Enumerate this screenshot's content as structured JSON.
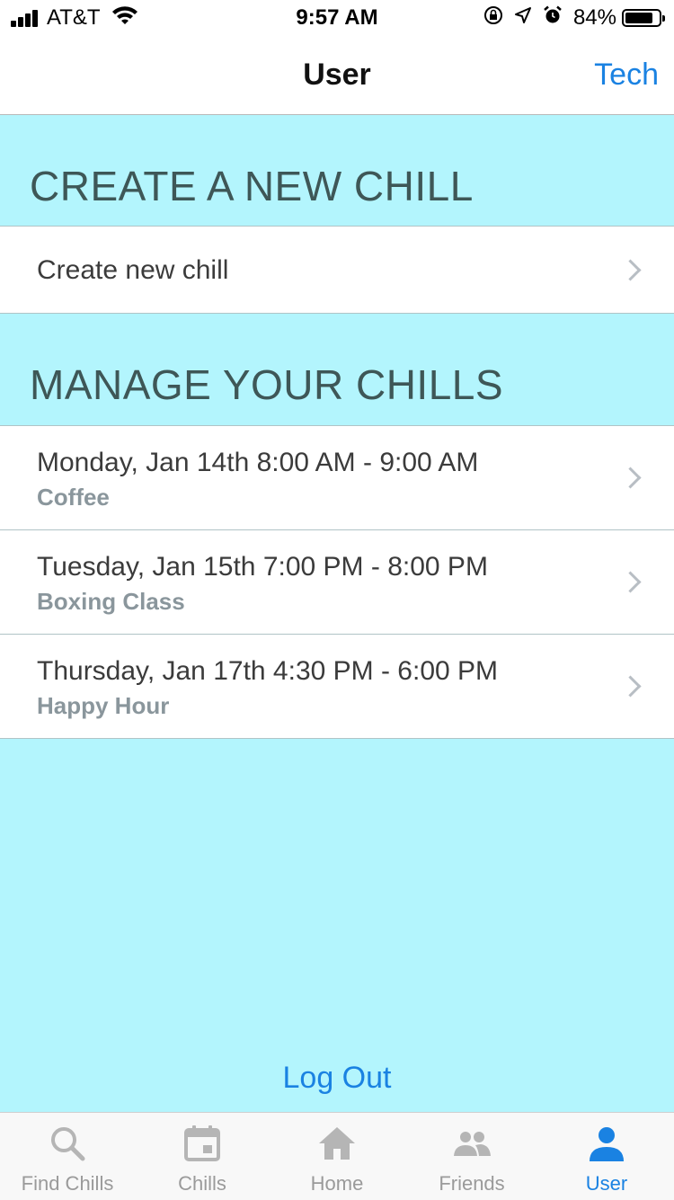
{
  "status_bar": {
    "carrier": "AT&T",
    "time": "9:57 AM",
    "battery_percent": "84%",
    "battery_level": 0.84,
    "icons": [
      "signal-icon",
      "wifi-icon",
      "rotation-lock-icon",
      "location-icon",
      "alarm-icon",
      "battery-icon"
    ]
  },
  "nav": {
    "title": "User",
    "right_button": "Tech"
  },
  "create_section": {
    "title": "CREATE A NEW CHILL",
    "row_label": "Create new chill"
  },
  "manage_section": {
    "title": "MANAGE YOUR CHILLS",
    "chills": [
      {
        "time": "Monday, Jan 14th 8:00 AM - 9:00 AM",
        "name": "Coffee"
      },
      {
        "time": "Tuesday, Jan 15th 7:00 PM - 8:00 PM",
        "name": "Boxing Class"
      },
      {
        "time": "Thursday, Jan 17th 4:30 PM - 6:00 PM",
        "name": "Happy Hour"
      }
    ]
  },
  "logout_label": "Log Out",
  "tabs": [
    {
      "label": "Find Chills",
      "icon": "search-icon",
      "active": false
    },
    {
      "label": "Chills",
      "icon": "calendar-icon",
      "active": false
    },
    {
      "label": "Home",
      "icon": "home-icon",
      "active": false
    },
    {
      "label": "Friends",
      "icon": "friends-icon",
      "active": false
    },
    {
      "label": "User",
      "icon": "user-icon",
      "active": true
    }
  ],
  "colors": {
    "background": "#b3f5fd",
    "accent": "#1a82e2",
    "section_title": "#3e5757",
    "subtitle": "#8a969c",
    "tab_inactive": "#b5b5b5"
  }
}
